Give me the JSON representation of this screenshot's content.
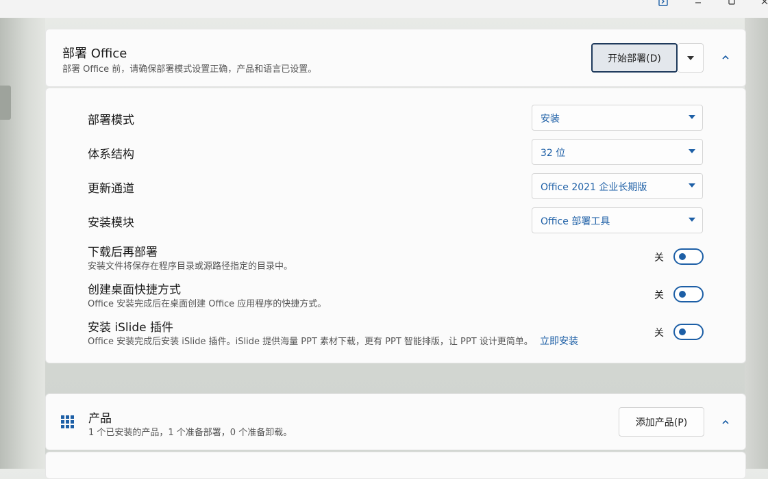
{
  "window": {
    "controls": [
      "sidebar-toggle-icon",
      "minimize-icon",
      "maximize-icon",
      "close-icon"
    ]
  },
  "deploy": {
    "title": "部署 Office",
    "subtitle": "部署 Office 前，请确保部署模式设置正确，产品和语言已设置。",
    "start_label": "开始部署(D)",
    "settings": {
      "mode": {
        "label": "部署模式",
        "value": "安装"
      },
      "arch": {
        "label": "体系结构",
        "value": "32 位"
      },
      "channel": {
        "label": "更新通道",
        "value": "Office 2021 企业长期版"
      },
      "module": {
        "label": "安装模块",
        "value": "Office 部署工具"
      }
    },
    "toggles": {
      "download_first": {
        "label": "下载后再部署",
        "desc": "安装文件将保存在程序目录或源路径指定的目录中。",
        "state": "关"
      },
      "desktop_shortcut": {
        "label": "创建桌面快捷方式",
        "desc": "Office 安装完成后在桌面创建 Office 应用程序的快捷方式。",
        "state": "关"
      },
      "islide": {
        "label": "安装 iSlide 插件",
        "desc": "Office 安装完成后安装 iSlide 插件。iSlide 提供海量 PPT 素材下载，更有 PPT 智能排版，让 PPT 设计更简单。",
        "link": "立即安装",
        "state": "关"
      }
    }
  },
  "products": {
    "title": "产品",
    "subtitle": "1 个已安装的产品，1 个准备部署，0 个准备卸载。",
    "add_label": "添加产品(P)"
  },
  "colors": {
    "accent": "#1d5fa6",
    "primary_border": "#1f3a5c"
  }
}
